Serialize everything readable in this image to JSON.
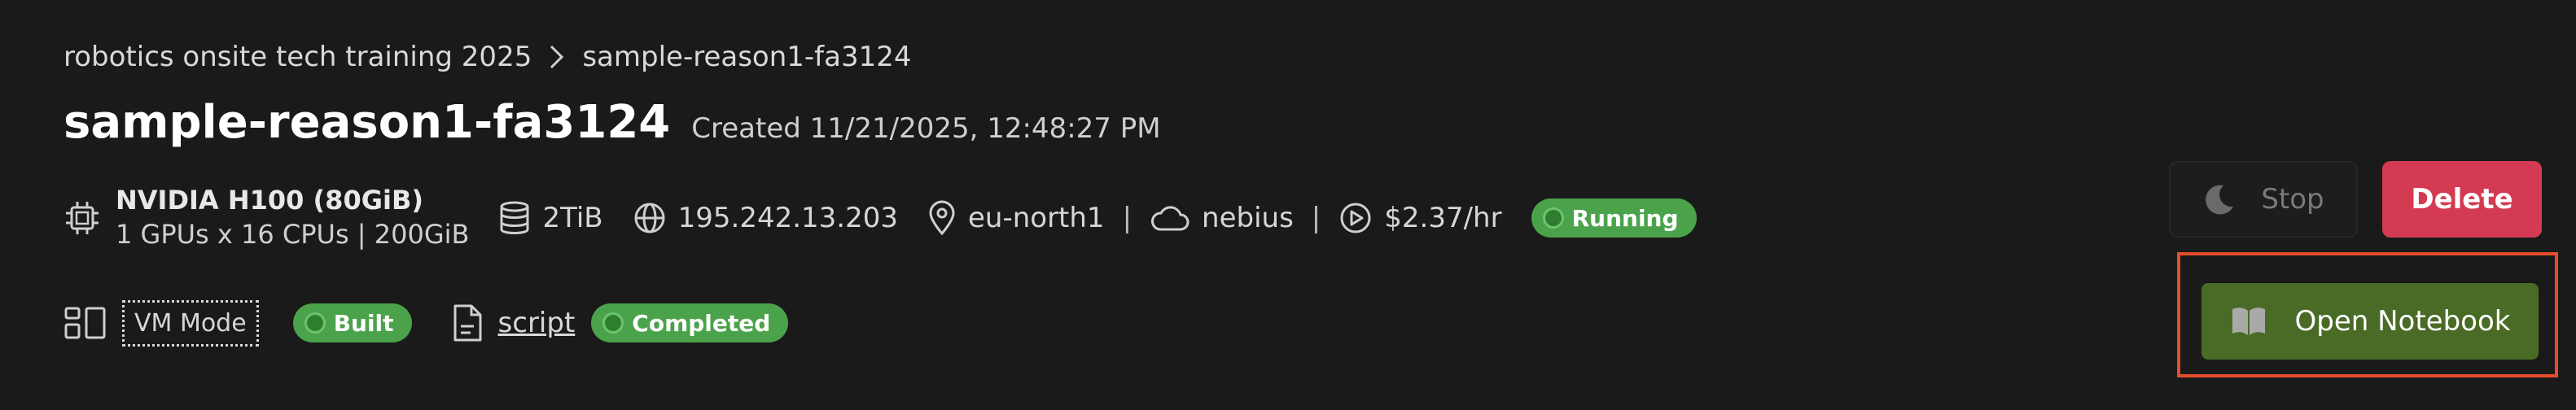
{
  "breadcrumb": {
    "parent": "robotics onsite tech training 2025",
    "current": "sample-reason1-fa3124"
  },
  "header": {
    "title": "sample-reason1-fa3124",
    "created": "Created 11/21/2025, 12:48:27 PM"
  },
  "specs": {
    "gpu_name": "NVIDIA H100 (80GiB)",
    "gpu_detail": "1 GPUs x 16 CPUs | 200GiB",
    "storage": "2TiB",
    "ip": "195.242.13.203",
    "region": "eu-north1",
    "provider": "nebius",
    "price": "$2.37/hr",
    "status": "Running",
    "pipe": "|"
  },
  "mode": {
    "vm_mode": "VM Mode",
    "build_status": "Built",
    "script_label": "script",
    "script_status": "Completed"
  },
  "actions": {
    "stop": "Stop",
    "delete": "Delete",
    "open_notebook": "Open Notebook"
  },
  "colors": {
    "background": "#1a1a1a",
    "status_green": "#4aa34a",
    "delete_red": "#d43b52",
    "notebook_green": "#4a6b26",
    "highlight": "#e54d2e"
  },
  "icons": [
    "chevron-right-icon",
    "chip-icon",
    "database-icon",
    "globe-icon",
    "location-pin-icon",
    "cloud-icon",
    "play-circle-icon",
    "layout-icon",
    "document-icon",
    "moon-icon",
    "book-icon"
  ]
}
